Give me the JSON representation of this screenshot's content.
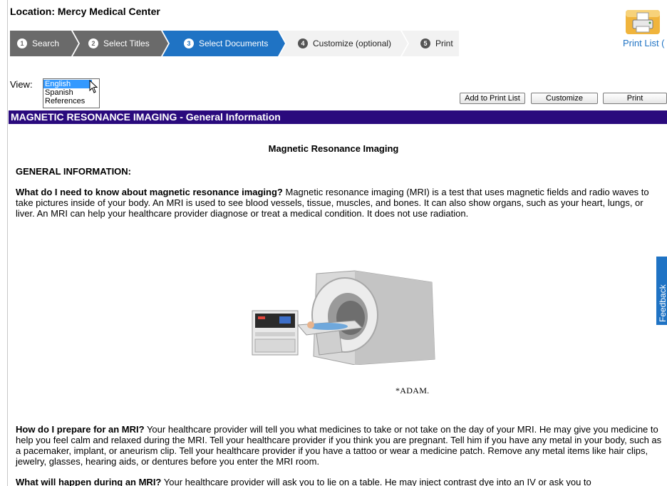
{
  "header": {
    "location_label": "Location:  Mercy Medical Center",
    "print_list_link": "Print List ("
  },
  "steps": [
    {
      "number": "1",
      "label": "Search"
    },
    {
      "number": "2",
      "label": "Select Titles"
    },
    {
      "number": "3",
      "label": "Select Documents"
    },
    {
      "number": "4",
      "label": "Customize (optional)"
    },
    {
      "number": "5",
      "label": "Print"
    }
  ],
  "view": {
    "label": "View:",
    "options": [
      "English",
      "Spanish",
      "References"
    ],
    "selected": "English"
  },
  "toolbar": {
    "add_label": "Add to Print List",
    "customize_label": "Customize",
    "print_label": "Print"
  },
  "document": {
    "title_bar": "MAGNETIC RESONANCE IMAGING - General Information",
    "title": "Magnetic Resonance Imaging",
    "section_heading": "GENERAL INFORMATION:",
    "p1_q": "What do I need to know about magnetic resonance imaging?",
    "p1_body": " Magnetic resonance imaging (MRI) is a test that uses magnetic fields and radio waves to take pictures inside of your body. An MRI is used to see blood vessels, tissue, muscles, and bones. It can also show organs, such as your heart, lungs, or liver. An MRI can help your healthcare provider diagnose or treat a medical condition. It does not use radiation.",
    "image_credit": "*ADAM.",
    "p2_q": "How do I prepare for an MRI?",
    "p2_body": " Your healthcare provider will tell you what medicines to take or not take on the day of your MRI. He may give you medicine to help you feel calm and relaxed during the MRI. Tell your healthcare provider if you think you are pregnant. Tell him if you have any metal in your body, such as a pacemaker, implant, or aneurism clip. Tell your healthcare provider if you have a tattoo or wear a medicine patch. Remove any metal items like hair clips, jewelry, glasses, hearing aids, or dentures before you enter the MRI room.",
    "p3_q": "What will happen during an MRI?",
    "p3_body": " Your healthcare provider will ask you to lie on a table. He may inject contrast dye into an IV or ask you to"
  },
  "feedback": {
    "label": "Feedback"
  },
  "colors": {
    "accent_blue": "#1f73c4",
    "title_bar": "#2a0a7d",
    "step_dark": "#6a6a6a"
  },
  "icons": [
    "printer-icon",
    "mouse-cursor-icon",
    "feedback-icon",
    "mri-scanner-image"
  ]
}
